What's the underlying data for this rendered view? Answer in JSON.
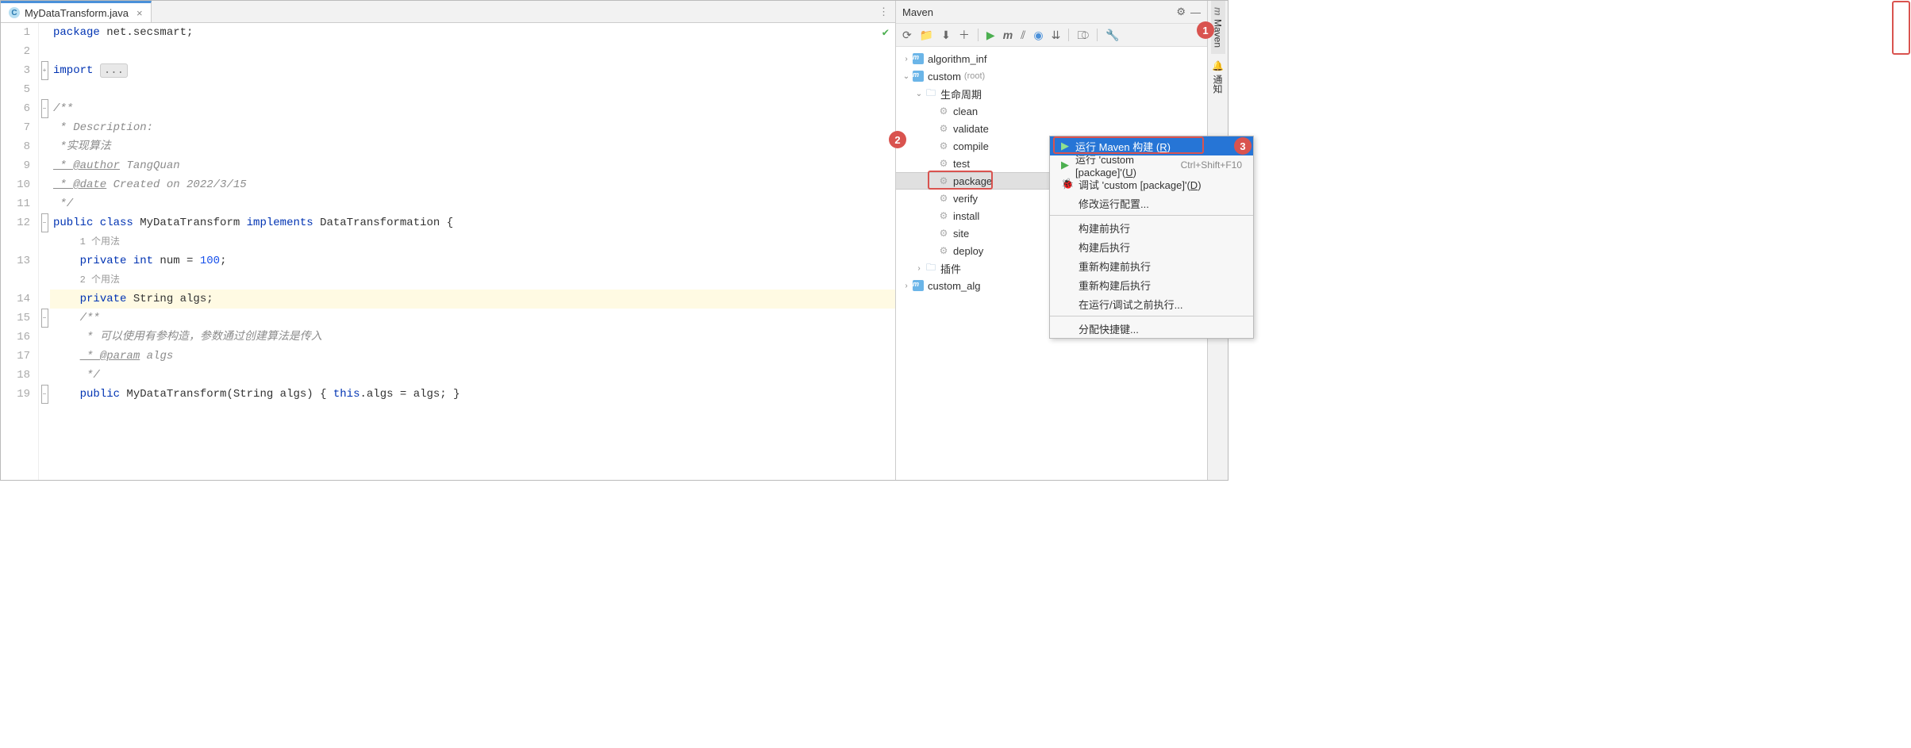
{
  "tab": {
    "filename": "MyDataTransform.java",
    "icon_letter": "C"
  },
  "code": {
    "lines": [
      {
        "n": 1,
        "html_key": "l1"
      },
      {
        "n": 2,
        "html_key": "blank"
      },
      {
        "n": 3,
        "html_key": "l3"
      },
      {
        "n": 5,
        "html_key": "blank"
      },
      {
        "n": 6,
        "html_key": "l6"
      },
      {
        "n": 7,
        "html_key": "l7"
      },
      {
        "n": 8,
        "html_key": "l8"
      },
      {
        "n": 9,
        "html_key": "l9"
      },
      {
        "n": 10,
        "html_key": "l10"
      },
      {
        "n": 11,
        "html_key": "l11"
      },
      {
        "n": 12,
        "html_key": "l12"
      },
      {
        "n": "",
        "html_key": "u1"
      },
      {
        "n": 13,
        "html_key": "l13"
      },
      {
        "n": "",
        "html_key": "u2"
      },
      {
        "n": 14,
        "html_key": "l14",
        "hl": true
      },
      {
        "n": 15,
        "html_key": "l15"
      },
      {
        "n": 16,
        "html_key": "l16"
      },
      {
        "n": 17,
        "html_key": "l17"
      },
      {
        "n": 18,
        "html_key": "l18"
      },
      {
        "n": 19,
        "html_key": "l19"
      }
    ],
    "content": {
      "l1": "package net.secsmart;",
      "l3": "import ...",
      "l6": "/**",
      "l7": " * Description:",
      "l8": " *实现算法",
      "l9_tag": " * @author",
      "l9_rest": " TangQuan",
      "l10_tag": " * @date",
      "l10_rest": " Created on 2022/3/15",
      "l11": " */",
      "l12": "public class MyDataTransform implements DataTransformation {",
      "u1": "1 个用法",
      "l13_a": "    private int num = ",
      "l13_num": "100",
      "l13_b": ";",
      "u2": "2 个用法",
      "l14": "    private String algs;",
      "l15": "    /**",
      "l16": "     * 可以使用有参构造，参数通过创建算法是传入",
      "l17_tag": "     * @param",
      "l17_rest": " algs",
      "l18": "     */",
      "l19": "    public MyDataTransform(String algs) { this.algs = algs; }"
    }
  },
  "maven": {
    "title": "Maven",
    "tree": {
      "algorithm_inf": "algorithm_inf",
      "custom": "custom",
      "root_suffix": "(root)",
      "lifecycle": "生命周期",
      "phases": [
        "clean",
        "validate",
        "compile",
        "test",
        "package",
        "verify",
        "install",
        "site",
        "deploy"
      ],
      "plugins": "插件",
      "custom_alg": "custom_alg"
    }
  },
  "context_menu": {
    "items": [
      {
        "label_pre": "运行 Maven 构建 (",
        "mn": "R",
        "label_post": ")",
        "icon": "run",
        "sel": true,
        "box": true
      },
      {
        "label_pre": "运行 'custom [package]'(",
        "mn": "U",
        "label_post": ")",
        "icon": "run",
        "shortcut": "Ctrl+Shift+F10"
      },
      {
        "label_pre": "调试 'custom [package]'(",
        "mn": "D",
        "label_post": ")",
        "icon": "bug"
      },
      {
        "label": "修改运行配置..."
      },
      {
        "sep": true
      },
      {
        "label": "构建前执行"
      },
      {
        "label": "构建后执行"
      },
      {
        "label": "重新构建前执行"
      },
      {
        "label": "重新构建后执行"
      },
      {
        "label": "在运行/调试之前执行..."
      },
      {
        "sep": true
      },
      {
        "label": "分配快捷键..."
      }
    ]
  },
  "rail": {
    "maven": "Maven",
    "notify": "通知"
  },
  "callouts": {
    "c1": "1",
    "c2": "2",
    "c3": "3"
  }
}
